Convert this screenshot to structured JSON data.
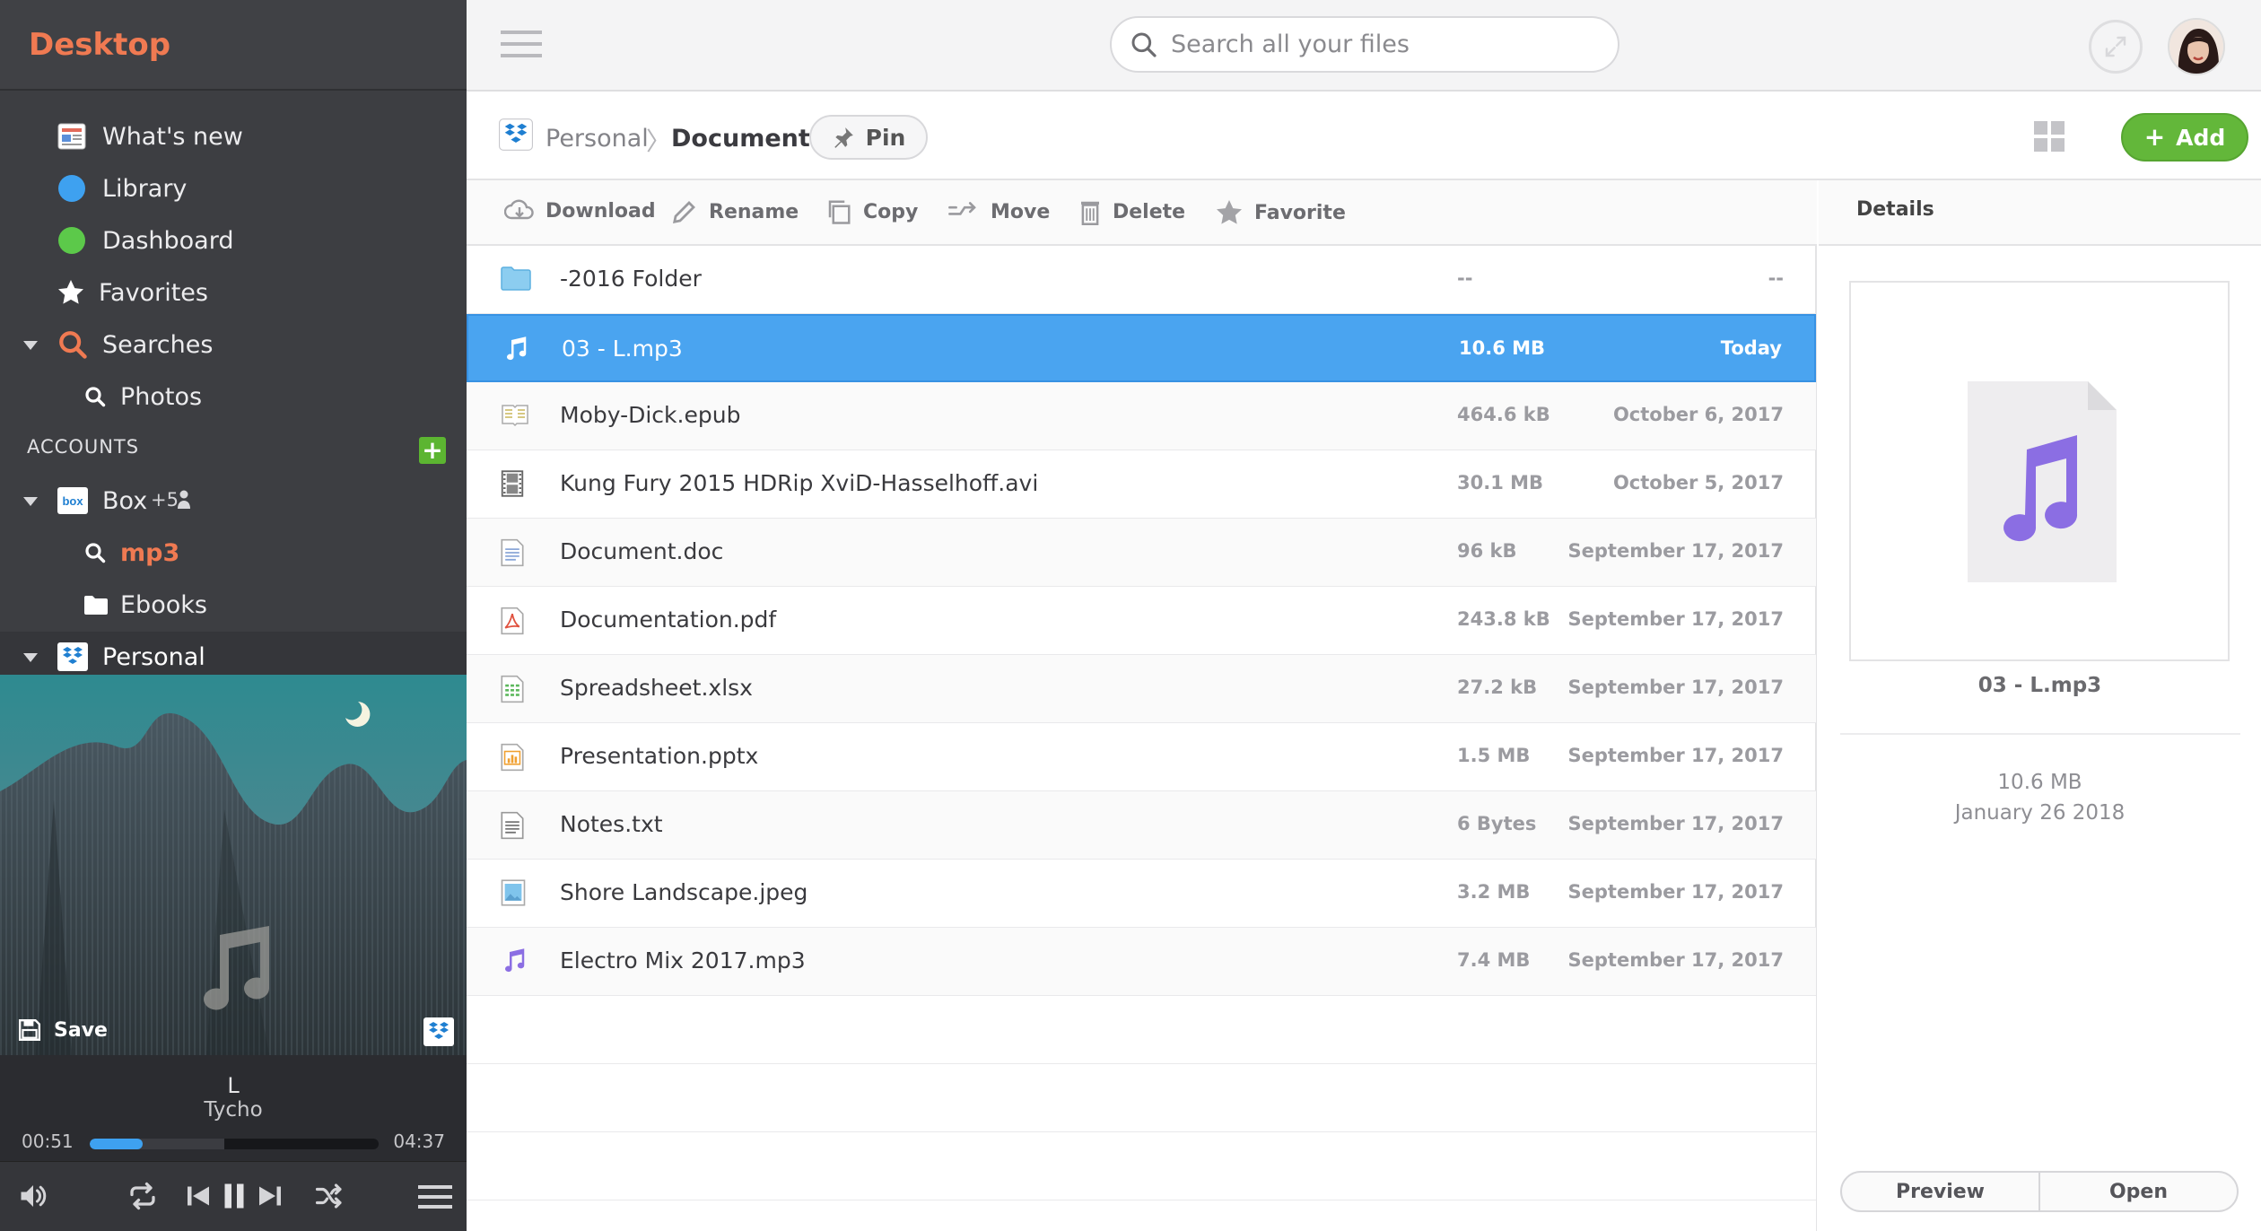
{
  "sidebar": {
    "title": "Desktop",
    "items": [
      {
        "label": "What's new",
        "icon": "newspaper-icon"
      },
      {
        "label": "Library",
        "icon": "blue-circle-icon",
        "color": "#3ea1f0"
      },
      {
        "label": "Dashboard",
        "icon": "green-circle-icon",
        "color": "#5cc94a"
      },
      {
        "label": "Favorites",
        "icon": "star-icon"
      },
      {
        "label": "Searches",
        "icon": "search-icon",
        "color": "#f07a52"
      },
      {
        "label": "Photos",
        "icon": "search-icon"
      }
    ],
    "accounts_header": "ACCOUNTS",
    "accounts_add": "+",
    "box_account": {
      "label": "Box",
      "shared": "+5",
      "icon": "box-logo-icon"
    },
    "box_children": [
      {
        "label": "mp3",
        "icon": "search-icon",
        "color": "#f07a52"
      },
      {
        "label": "Ebooks",
        "icon": "folder-icon"
      }
    ],
    "personal_account": {
      "label": "Personal",
      "icon": "dropbox-logo-icon"
    }
  },
  "album": {
    "save_label": "Save"
  },
  "player": {
    "track_title": "L",
    "artist": "Tycho",
    "current_time": "00:51",
    "total_time": "04:37",
    "progress": 0.184,
    "progress_color": "#3ea1f0"
  },
  "search": {
    "placeholder": "Search all your files"
  },
  "breadcrumb": {
    "root": "Personal",
    "separator": "〉",
    "current": "Documents"
  },
  "pin_label": "Pin",
  "add_label": "Add",
  "toolbar": {
    "download": "Download",
    "rename": "Rename",
    "copy": "Copy",
    "move": "Move",
    "delete": "Delete",
    "favorite": "Favorite"
  },
  "files": [
    {
      "name": "-2016 Folder",
      "size": "--",
      "date": "--",
      "icon": "folder-icon"
    },
    {
      "name": "03 - L.mp3",
      "size": "10.6 MB",
      "date": "Today",
      "icon": "music-note-icon",
      "selected": true
    },
    {
      "name": "Moby-Dick.epub",
      "size": "464.6 kB",
      "date": "October 6, 2017",
      "icon": "book-icon"
    },
    {
      "name": "Kung Fury 2015 HDRip XviD-Hasselhoff.avi",
      "size": "30.1 MB",
      "date": "October 5, 2017",
      "icon": "film-icon"
    },
    {
      "name": "Document.doc",
      "size": "96 kB",
      "date": "September 17, 2017",
      "icon": "document-icon"
    },
    {
      "name": "Documentation.pdf",
      "size": "243.8 kB",
      "date": "September 17, 2017",
      "icon": "pdf-icon"
    },
    {
      "name": "Spreadsheet.xlsx",
      "size": "27.2 kB",
      "date": "September 17, 2017",
      "icon": "spreadsheet-icon"
    },
    {
      "name": "Presentation.pptx",
      "size": "1.5 MB",
      "date": "September 17, 2017",
      "icon": "presentation-icon"
    },
    {
      "name": "Notes.txt",
      "size": "6 Bytes",
      "date": "September 17, 2017",
      "icon": "text-file-icon"
    },
    {
      "name": "Shore Landscape.jpeg",
      "size": "3.2 MB",
      "date": "September 17, 2017",
      "icon": "image-icon"
    },
    {
      "name": "Electro Mix 2017.mp3",
      "size": "7.4 MB",
      "date": "September 17, 2017",
      "icon": "music-note-icon"
    }
  ],
  "details": {
    "header": "Details",
    "file_name": "03 - L.mp3",
    "size": "10.6 MB",
    "date": "January 26 2018",
    "preview_label": "Preview",
    "open_label": "Open"
  },
  "colors": {
    "accent": "#f07a52",
    "selection": "#4aa4f0",
    "add_green": "#63b73a",
    "music_purple": "#8b6ee3"
  }
}
